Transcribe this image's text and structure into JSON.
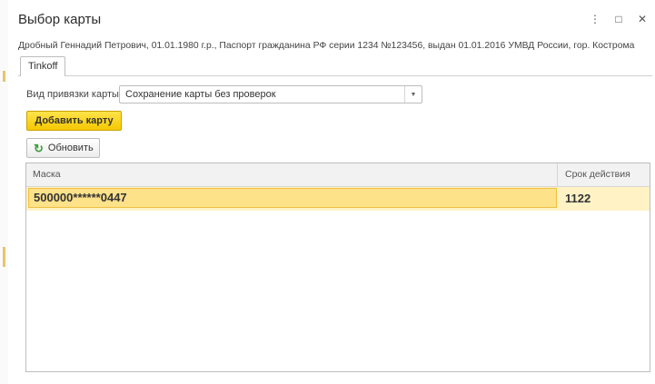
{
  "window": {
    "title": "Выбор карты",
    "controls": {
      "menu": "⋮",
      "maximize": "□",
      "close": "✕"
    },
    "subtitle": "Дробный Геннадий Петрович, 01.01.1980 г.р., Паспорт гражданина РФ серии 1234 №123456, выдан 01.01.2016 УМВД России, гор. Кострома"
  },
  "tabs": [
    {
      "label": "Tinkoff"
    }
  ],
  "form": {
    "binding_type_label": "Вид привязки карты:",
    "binding_type_value": "Сохранение карты без проверок"
  },
  "buttons": {
    "add_card": "Добавить карту",
    "refresh": "Обновить"
  },
  "table": {
    "columns": [
      "Маска",
      "Срок действия"
    ],
    "rows": [
      {
        "mask": "500000******0447",
        "expiry": "1122"
      }
    ]
  },
  "colors": {
    "accent_yellow": "#f5c800",
    "selected_row": "#fde28a",
    "refresh_icon": "#3b9d3b"
  },
  "icons": {
    "refresh": "refresh-icon",
    "dropdown": "dropdown-arrow-icon"
  }
}
